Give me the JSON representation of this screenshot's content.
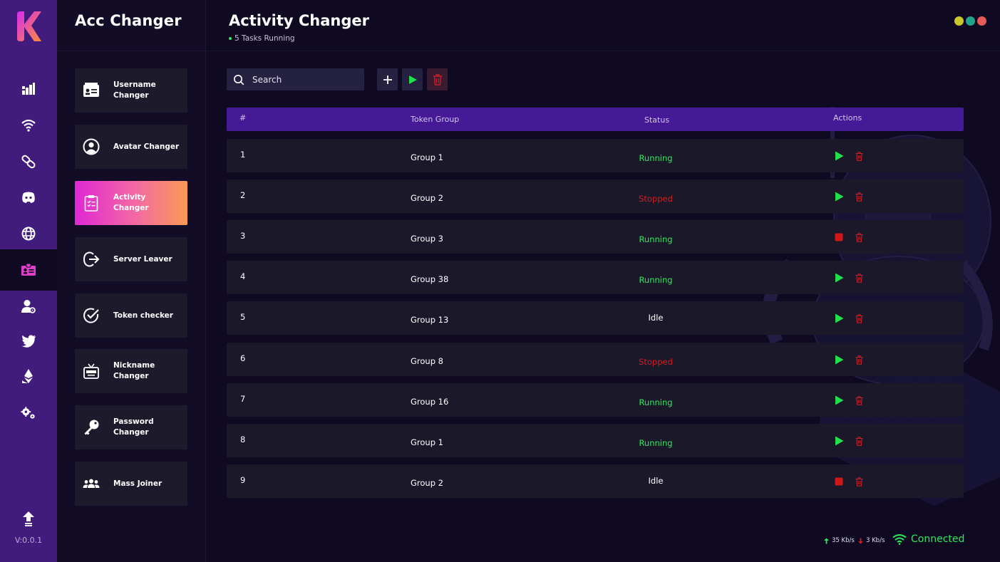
{
  "app": {
    "title": "Acc Changer",
    "version": "V:0.0.1"
  },
  "rail": {
    "items": [
      {
        "icon": "bar-chart-icon"
      },
      {
        "icon": "wifi-icon"
      },
      {
        "icon": "link-icon"
      },
      {
        "icon": "discord-icon"
      },
      {
        "icon": "globe-icon"
      },
      {
        "icon": "id-card-icon",
        "active": true
      },
      {
        "icon": "user-settings-icon"
      },
      {
        "icon": "twitter-icon"
      },
      {
        "icon": "ethereum-icon"
      },
      {
        "icon": "settings-gear-icon"
      },
      {
        "icon": "upload-icon"
      }
    ],
    "active_color": "#e040c8"
  },
  "features": [
    {
      "label": "Username Changer",
      "icon": "username-card-icon"
    },
    {
      "label": "Avatar Changer",
      "icon": "avatar-icon"
    },
    {
      "label": "Activity Changer",
      "icon": "clipboard-icon",
      "active": true
    },
    {
      "label": "Server Leaver",
      "icon": "logout-icon"
    },
    {
      "label": "Token checker",
      "icon": "check-circle-icon"
    },
    {
      "label": "Nickname Changer",
      "icon": "tv-icon"
    },
    {
      "label": "Password Changer",
      "icon": "key-icon"
    },
    {
      "label": "Mass Joiner",
      "icon": "users-icon"
    }
  ],
  "header": {
    "title": "Activity Changer",
    "status": "5 Tasks Running",
    "window_dots": [
      "#c8c82a",
      "#1fa58a",
      "#e85a5a"
    ]
  },
  "toolbar": {
    "search_placeholder": "Search",
    "add_icon": "plus-icon",
    "play_all_icon": "play-icon",
    "delete_all_icon": "trash-icon"
  },
  "table": {
    "headers": [
      "#",
      "Token Group",
      "Status",
      "Actions"
    ],
    "rows": [
      {
        "num": "1",
        "group": "Group 1",
        "status": "Running",
        "action": "play"
      },
      {
        "num": "2",
        "group": "Group 2",
        "status": "Stopped",
        "action": "play"
      },
      {
        "num": "3",
        "group": "Group 3",
        "status": "Running",
        "action": "stop"
      },
      {
        "num": "4",
        "group": "Group 38",
        "status": "Running",
        "action": "play"
      },
      {
        "num": "5",
        "group": "Group 13",
        "status": "Idle",
        "action": "play"
      },
      {
        "num": "6",
        "group": "Group 8",
        "status": "Stopped",
        "action": "play"
      },
      {
        "num": "7",
        "group": "Group 16",
        "status": "Running",
        "action": "play"
      },
      {
        "num": "8",
        "group": "Group 1",
        "status": "Running",
        "action": "play"
      },
      {
        "num": "9",
        "group": "Group 2",
        "status": "Idle",
        "action": "stop"
      }
    ]
  },
  "colors": {
    "running": "#2ee85e",
    "stopped": "#d41e1e",
    "idle": "#ffffff",
    "play": "#22e04c",
    "stop": "#d01818",
    "delete": "#c4202a"
  },
  "footer": {
    "upload_speed": "35 Kb/s",
    "download_speed": "3 Kb/s",
    "connection": "Connected"
  }
}
